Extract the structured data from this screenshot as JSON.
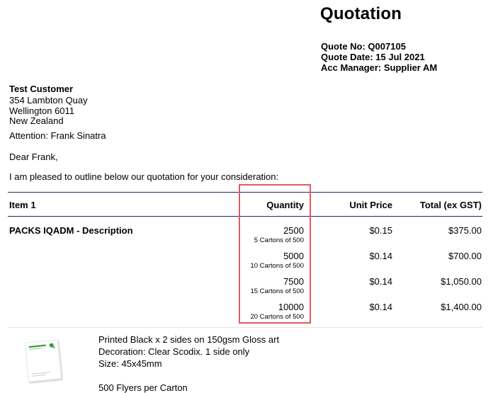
{
  "header": {
    "title": "Quotation",
    "quote_no": "Quote No: Q007105",
    "quote_date": "Quote Date: 15 Jul 2021",
    "acc_manager": "Acc Manager: Supplier AM"
  },
  "customer": {
    "name": "Test Customer",
    "address_lines": [
      "354 Lambton Quay",
      "Wellington 6011",
      "New Zealand"
    ],
    "attention": "Attention: Frank Sinatra"
  },
  "letter": {
    "greeting": "Dear Frank,",
    "intro": "I am pleased to outline below our quotation for your consideration:"
  },
  "table": {
    "headers": {
      "item": "Item 1",
      "quantity": "Quantity",
      "unit_price": "Unit Price",
      "total": "Total (ex GST)"
    },
    "item_description": "PACKS IQADM - Description",
    "rows": [
      {
        "quantity": "2500",
        "cartons": "5 Cartons of 500",
        "unit_price": "$0.15",
        "total": "$375.00"
      },
      {
        "quantity": "5000",
        "cartons": "10 Cartons of 500",
        "unit_price": "$0.14",
        "total": "$700.00"
      },
      {
        "quantity": "7500",
        "cartons": "15 Cartons of 500",
        "unit_price": "$0.14",
        "total": "$1,050.00"
      },
      {
        "quantity": "10000",
        "cartons": "20 Cartons of 500",
        "unit_price": "$0.14",
        "total": "$1,400.00"
      }
    ]
  },
  "product": {
    "lines": [
      "Printed Black x 2 sides on 150gsm Gloss art",
      "Decoration: Clear Scodix. 1 side only",
      "Size: 45x45mm",
      "500 Flyers per Carton"
    ]
  },
  "colors": {
    "table_rule": "#1f2a5c",
    "light_rule": "#d9d9d9",
    "highlight": "#e05a5f",
    "logo_green": "#3a9a3a"
  }
}
